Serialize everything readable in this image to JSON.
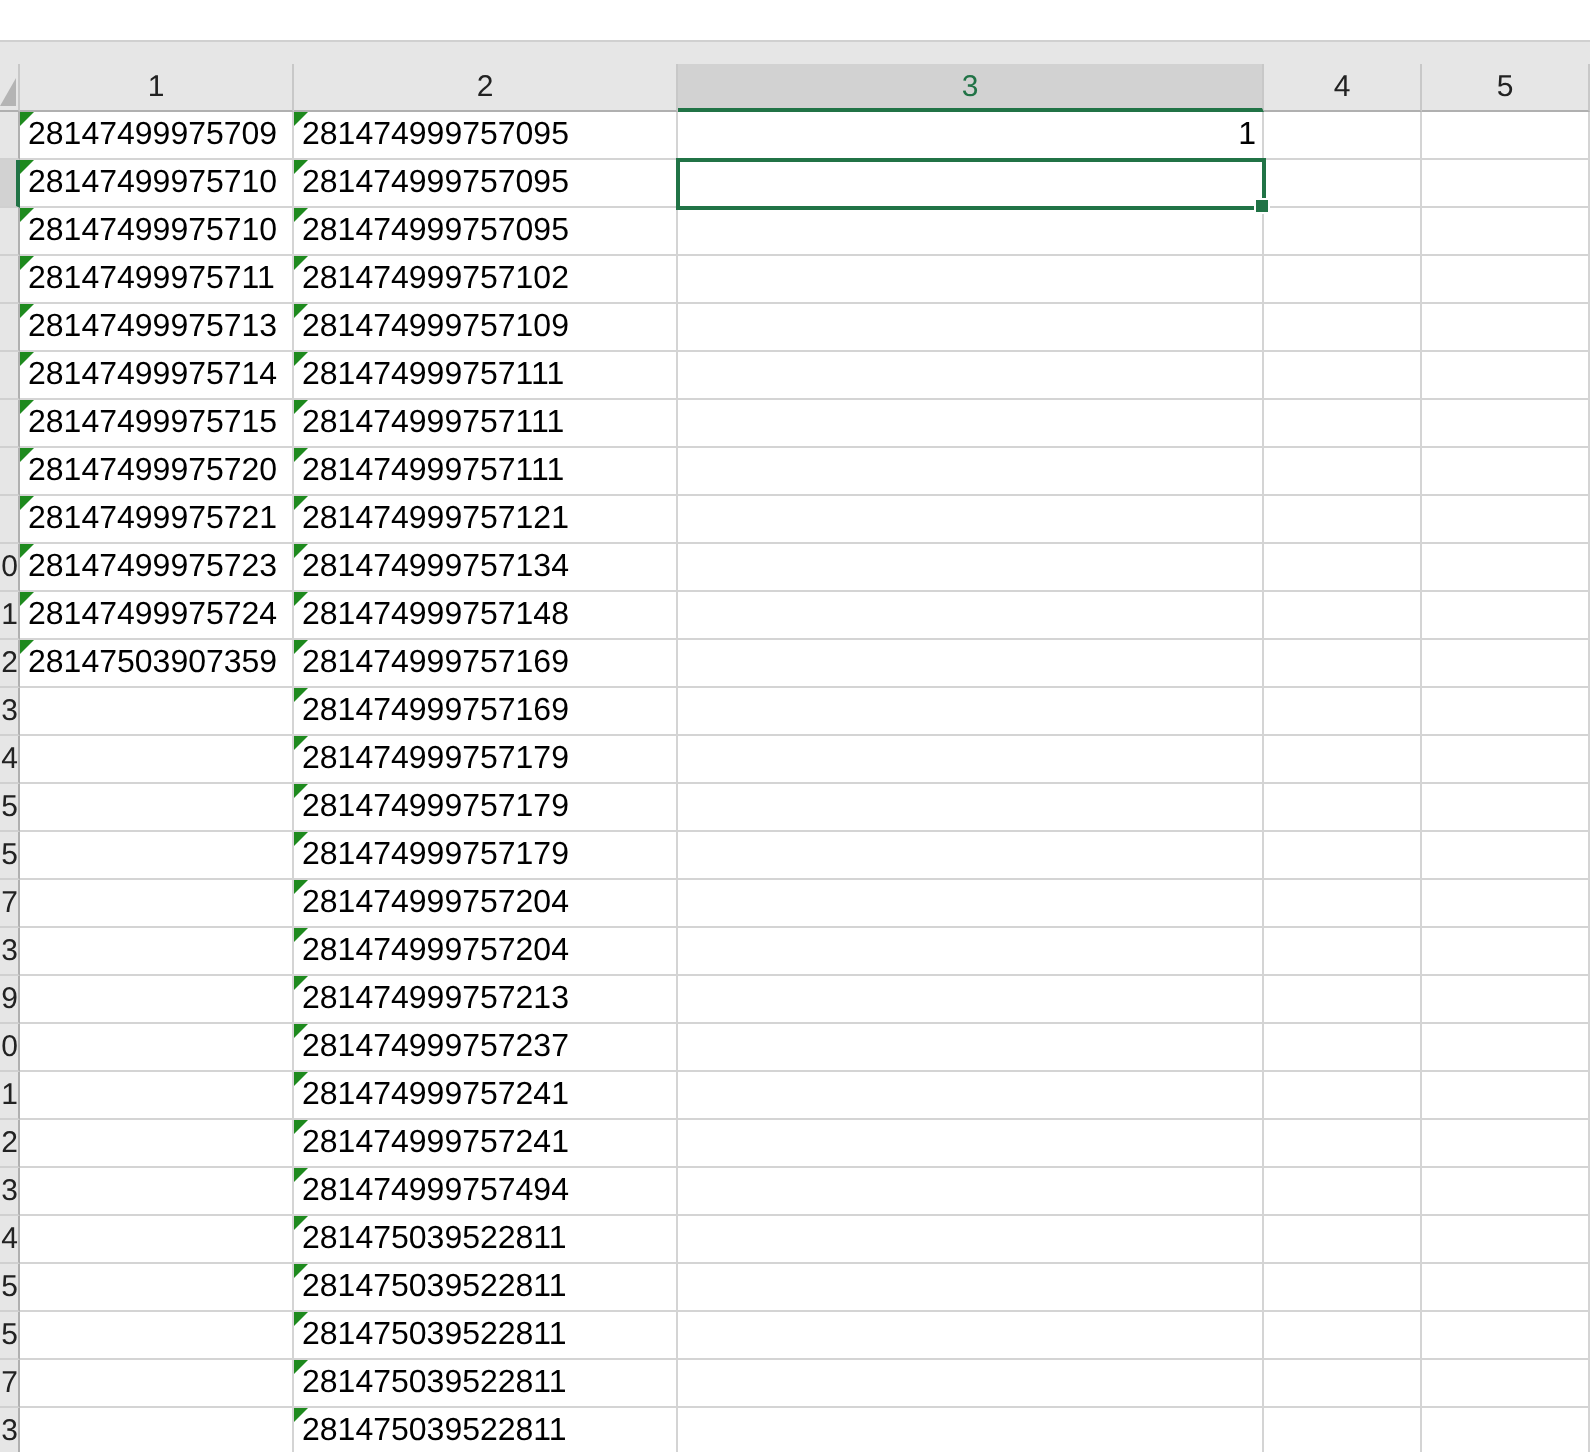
{
  "columns": [
    {
      "label": "1",
      "selected": false
    },
    {
      "label": "2",
      "selected": false
    },
    {
      "label": "3",
      "selected": true
    },
    {
      "label": "4",
      "selected": false
    },
    {
      "label": "5",
      "selected": false
    }
  ],
  "rows": [
    {
      "selected": false,
      "cells": [
        {
          "text": "28147499975709",
          "warning": true
        },
        {
          "text": "281474999757095",
          "warning": true
        },
        {
          "text": "1",
          "warning": false
        },
        {},
        {}
      ]
    },
    {
      "selected": true,
      "cells": [
        {
          "text": "28147499975710",
          "warning": true
        },
        {
          "text": "281474999757095",
          "warning": true
        },
        {},
        {},
        {}
      ]
    },
    {
      "selected": false,
      "cells": [
        {
          "text": "28147499975710",
          "warning": true
        },
        {
          "text": "281474999757095",
          "warning": true
        },
        {},
        {},
        {}
      ]
    },
    {
      "selected": false,
      "cells": [
        {
          "text": "28147499975711",
          "warning": true
        },
        {
          "text": "281474999757102",
          "warning": true
        },
        {},
        {},
        {}
      ]
    },
    {
      "selected": false,
      "cells": [
        {
          "text": "28147499975713",
          "warning": true
        },
        {
          "text": "281474999757109",
          "warning": true
        },
        {},
        {},
        {}
      ]
    },
    {
      "selected": false,
      "cells": [
        {
          "text": "28147499975714",
          "warning": true
        },
        {
          "text": "281474999757111",
          "warning": true
        },
        {},
        {},
        {}
      ]
    },
    {
      "selected": false,
      "cells": [
        {
          "text": "28147499975715",
          "warning": true
        },
        {
          "text": "281474999757111",
          "warning": true
        },
        {},
        {},
        {}
      ]
    },
    {
      "selected": false,
      "cells": [
        {
          "text": "28147499975720",
          "warning": true
        },
        {
          "text": "281474999757111",
          "warning": true
        },
        {},
        {},
        {}
      ]
    },
    {
      "selected": false,
      "cells": [
        {
          "text": "28147499975721",
          "warning": true
        },
        {
          "text": "281474999757121",
          "warning": true
        },
        {},
        {},
        {}
      ]
    },
    {
      "header": "0",
      "selected": false,
      "cells": [
        {
          "text": "28147499975723",
          "warning": true
        },
        {
          "text": "281474999757134",
          "warning": true
        },
        {},
        {},
        {}
      ]
    },
    {
      "header": "1",
      "selected": false,
      "cells": [
        {
          "text": "28147499975724",
          "warning": true
        },
        {
          "text": "281474999757148",
          "warning": true
        },
        {},
        {},
        {}
      ]
    },
    {
      "header": "2",
      "selected": false,
      "cells": [
        {
          "text": "28147503907359",
          "warning": true
        },
        {
          "text": "281474999757169",
          "warning": true
        },
        {},
        {},
        {}
      ]
    },
    {
      "header": "3",
      "selected": false,
      "cells": [
        {},
        {
          "text": "281474999757169",
          "warning": true
        },
        {},
        {},
        {}
      ]
    },
    {
      "header": "4",
      "selected": false,
      "cells": [
        {},
        {
          "text": "281474999757179",
          "warning": true
        },
        {},
        {},
        {}
      ]
    },
    {
      "header": "5",
      "selected": false,
      "cells": [
        {},
        {
          "text": "281474999757179",
          "warning": true
        },
        {},
        {},
        {}
      ]
    },
    {
      "header": "5",
      "selected": false,
      "cells": [
        {},
        {
          "text": "281474999757179",
          "warning": true
        },
        {},
        {},
        {}
      ]
    },
    {
      "header": "7",
      "selected": false,
      "cells": [
        {},
        {
          "text": "281474999757204",
          "warning": true
        },
        {},
        {},
        {}
      ]
    },
    {
      "header": "3",
      "selected": false,
      "cells": [
        {},
        {
          "text": "281474999757204",
          "warning": true
        },
        {},
        {},
        {}
      ]
    },
    {
      "header": "9",
      "selected": false,
      "cells": [
        {},
        {
          "text": "281474999757213",
          "warning": true
        },
        {},
        {},
        {}
      ]
    },
    {
      "header": "0",
      "selected": false,
      "cells": [
        {},
        {
          "text": "281474999757237",
          "warning": true
        },
        {},
        {},
        {}
      ]
    },
    {
      "header": "1",
      "selected": false,
      "cells": [
        {},
        {
          "text": "281474999757241",
          "warning": true
        },
        {},
        {},
        {}
      ]
    },
    {
      "header": "2",
      "selected": false,
      "cells": [
        {},
        {
          "text": "281474999757241",
          "warning": true
        },
        {},
        {},
        {}
      ]
    },
    {
      "header": "3",
      "selected": false,
      "cells": [
        {},
        {
          "text": "281474999757494",
          "warning": true
        },
        {},
        {},
        {}
      ]
    },
    {
      "header": "4",
      "selected": false,
      "cells": [
        {},
        {
          "text": "281475039522811",
          "warning": true
        },
        {},
        {},
        {}
      ]
    },
    {
      "header": "5",
      "selected": false,
      "cells": [
        {},
        {
          "text": "281475039522811",
          "warning": true
        },
        {},
        {},
        {}
      ]
    },
    {
      "header": "5",
      "selected": false,
      "cells": [
        {},
        {
          "text": "281475039522811",
          "warning": true
        },
        {},
        {},
        {}
      ]
    },
    {
      "header": "7",
      "selected": false,
      "cells": [
        {},
        {
          "text": "281475039522811",
          "warning": true
        },
        {},
        {},
        {}
      ]
    },
    {
      "header": "3",
      "selected": false,
      "cells": [
        {},
        {
          "text": "281475039522811",
          "warning": true
        },
        {},
        {},
        {}
      ]
    }
  ]
}
